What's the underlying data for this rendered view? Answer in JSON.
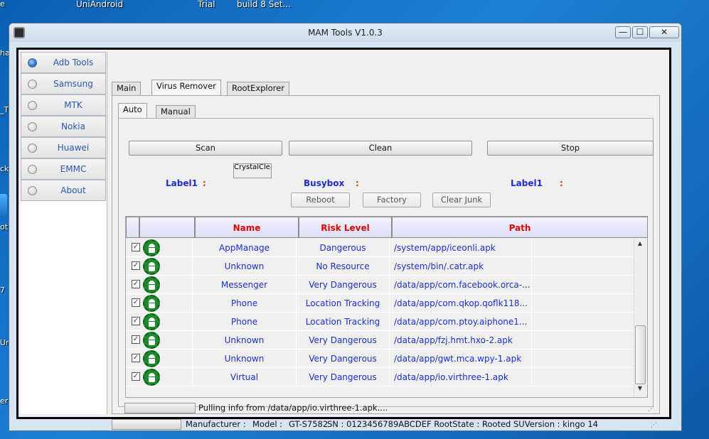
{
  "desktop": {
    "labels": [
      "UniAndroid",
      "Trial",
      "build 8 Set..."
    ],
    "left_fragments": [
      "e",
      "ha",
      "_T",
      "ck",
      "ot",
      "7",
      "Un",
      "er"
    ]
  },
  "window": {
    "title": "MAM Tools V1.0.3",
    "controls": {
      "minimize": "—",
      "maximize": "☐",
      "close": "✕"
    }
  },
  "sidebar": {
    "items": [
      {
        "label": "Adb Tools",
        "selected": true
      },
      {
        "label": "Samsung",
        "selected": false
      },
      {
        "label": "MTK",
        "selected": false
      },
      {
        "label": "Nokia",
        "selected": false
      },
      {
        "label": "Huawei",
        "selected": false
      },
      {
        "label": "EMMC",
        "selected": false
      },
      {
        "label": "About",
        "selected": false
      }
    ]
  },
  "tabs": [
    "Main",
    "Virus Remover",
    "RootExplorer"
  ],
  "active_tab": "Virus Remover",
  "subtabs": [
    "Auto",
    "Manual"
  ],
  "active_subtab": "Auto",
  "actions": {
    "scan": "Scan",
    "clean": "Clean",
    "stop": "Stop"
  },
  "crystal_button": "CrystalClearButt",
  "labels": {
    "label1_left": "Label1",
    "busybox": "Busybox",
    "label1_right": "Label1",
    "colon": ":"
  },
  "small_buttons": {
    "reboot": "Reboot",
    "factory": "Factory",
    "clear_junk": "Clear Junk"
  },
  "table": {
    "headers": [
      "Name",
      "Risk Level",
      "Path"
    ],
    "rows": [
      {
        "checked": true,
        "name": "AppManage",
        "risk": "Dangerous",
        "path": "/system/app/iceonli.apk"
      },
      {
        "checked": true,
        "name": "Unknown",
        "risk": "No Resource",
        "path": "/system/bin/.catr.apk"
      },
      {
        "checked": true,
        "name": "Messenger",
        "risk": "Very Dangerous",
        "path": "/data/app/com.facebook.orca-..."
      },
      {
        "checked": true,
        "name": "Phone",
        "risk": "Location Tracking",
        "path": "/data/app/com.qkop.qoflk118..."
      },
      {
        "checked": true,
        "name": "Phone",
        "risk": "Location Tracking",
        "path": "/data/app/com.ptoy.aiphone1..."
      },
      {
        "checked": true,
        "name": "Unknown",
        "risk": "Very Dangerous",
        "path": "/data/app/fzj.hmt.hxo-2.apk"
      },
      {
        "checked": true,
        "name": "Unknown",
        "risk": "Very Dangerous",
        "path": "/data/app/gwt.mca.wpy-1.apk"
      },
      {
        "checked": true,
        "name": "Virtual",
        "risk": "Very Dangerous",
        "path": "/data/app/io.virthree-1.apk"
      }
    ],
    "check_glyph": "✓"
  },
  "status": {
    "pulling": "Pulling info from /data/app/io.virthree-1.apk...."
  },
  "device": {
    "manufacturer": "Manufacturer :",
    "model": "Model :",
    "model_value": "GT-S7582",
    "info": "SN : 0123456789ABCDEF RootState : Rooted SUVersion : kingo 14"
  },
  "colors": {
    "label_blue": "#1f2ccf",
    "header_red": "#e00000",
    "colon_orange": "#d23a00",
    "android_green": "#1c8a2a"
  }
}
